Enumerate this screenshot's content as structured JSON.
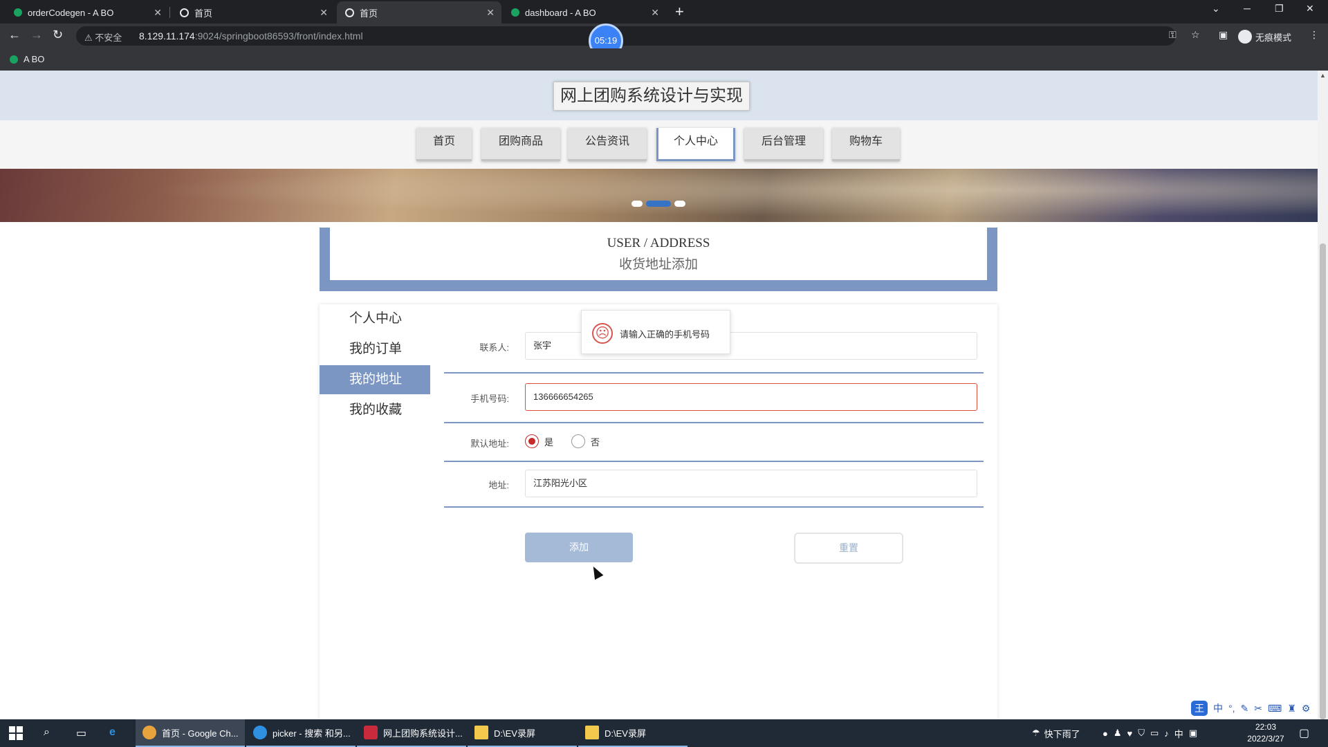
{
  "browser": {
    "tabs": [
      {
        "title": "orderCodegen - A BO"
      },
      {
        "title": "首页"
      },
      {
        "title": "首页"
      },
      {
        "title": "dashboard - A BO"
      }
    ],
    "address": {
      "security_label": "不安全",
      "host": "8.129.11.174",
      "path": ":9024/springboot86593/front/index.html"
    },
    "timer": "05:19",
    "incognito_label": "无痕模式",
    "bookmark": "A BO"
  },
  "site": {
    "title": "网上团购系统设计与实现",
    "nav": [
      "首页",
      "团购商品",
      "公告资讯",
      "个人中心",
      "后台管理",
      "购物车"
    ],
    "active_nav": "个人中心"
  },
  "section": {
    "title_en": "USER / ADDRESS",
    "title_cn": "收货地址添加"
  },
  "side_menu": {
    "items": [
      "个人中心",
      "我的订单",
      "我的地址",
      "我的收藏"
    ],
    "active": "我的地址"
  },
  "form": {
    "contact_label": "联系人:",
    "contact_value": "张宇",
    "phone_label": "手机号码:",
    "phone_value": "136666654265",
    "default_label": "默认地址:",
    "default_yes": "是",
    "default_no": "否",
    "default_selected": "是",
    "address_label": "地址:",
    "address_value": "江苏阳光小区",
    "add_button": "添加",
    "reset_button": "重置"
  },
  "toast": {
    "message": "请输入正确的手机号码",
    "status_color": "#d9534f"
  },
  "taskbar": {
    "apps": [
      {
        "label": "首页 - Google Ch..."
      },
      {
        "label": "picker - 搜索 和另..."
      },
      {
        "label": "网上团购系统设计..."
      },
      {
        "label": "D:\\EV录屏"
      },
      {
        "label": "D:\\EV录屏"
      }
    ],
    "weather": "快下雨了",
    "ime_lang": "中",
    "time": "22:03",
    "date": "2022/3/27"
  },
  "colors": {
    "accent": "#7b96c3",
    "error": "#e04a3a",
    "radio_checked": "#c52b2b"
  }
}
